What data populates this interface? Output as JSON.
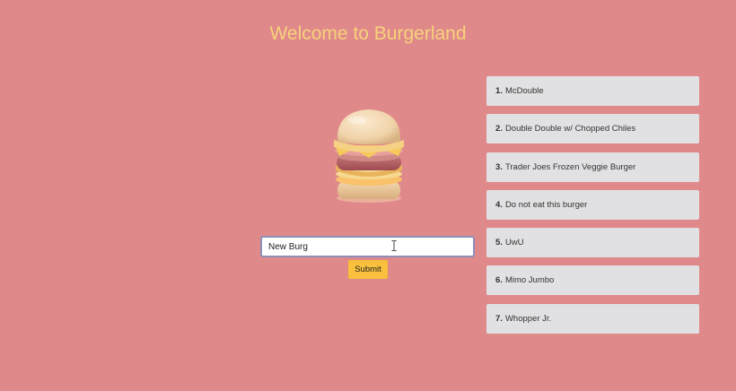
{
  "header": {
    "title": "Welcome to Burgerland"
  },
  "form": {
    "input_value": "New Burg",
    "submit_label": "Submit"
  },
  "burgers": [
    {
      "number": "1.",
      "name": "McDouble"
    },
    {
      "number": "2.",
      "name": "Double Double w/ Chopped Chiles"
    },
    {
      "number": "3.",
      "name": "Trader Joes Frozen Veggie Burger"
    },
    {
      "number": "4.",
      "name": "Do not eat this burger"
    },
    {
      "number": "5.",
      "name": "UwU"
    },
    {
      "number": "6.",
      "name": "Mimo Jumbo"
    },
    {
      "number": "7.",
      "name": "Whopper Jr."
    }
  ],
  "colors": {
    "background": "#e0898b",
    "title": "#f6d27a",
    "button": "#f8c03c",
    "list_item": "#e1e1e3"
  },
  "icons": {
    "burger": "burger-icon",
    "cursor": "text-cursor-icon"
  }
}
